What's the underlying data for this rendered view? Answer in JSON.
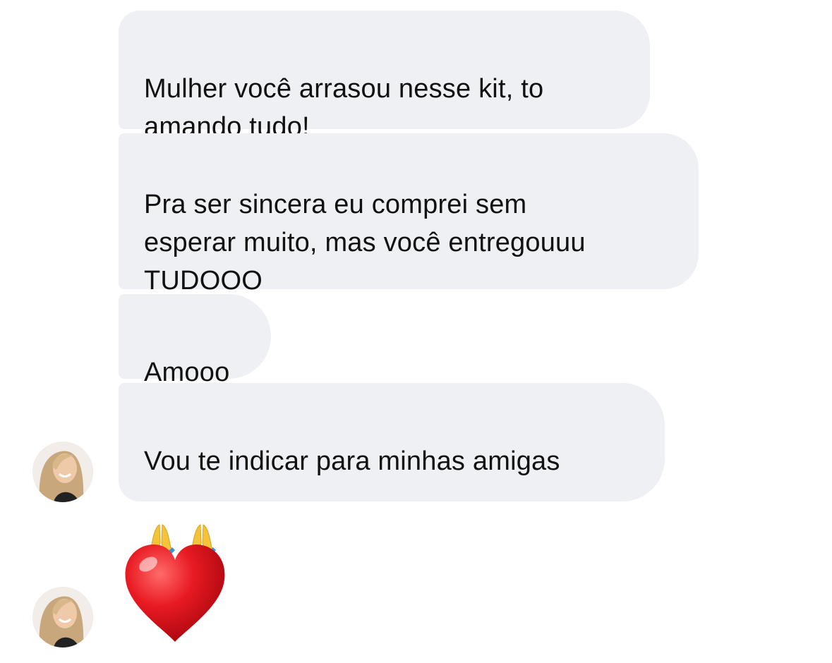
{
  "conversation": {
    "messages": [
      {
        "text": "Mulher você arrasou nesse kit, to\namando tudo!"
      },
      {
        "text": "Pra ser sincera eu comprei sem\nesperar muito, mas você entregouuu\nTUDOOO"
      },
      {
        "text": "Amooo"
      },
      {
        "text": "Vou te indicar para minhas amigas",
        "emojis": [
          "folded-hands-emoji",
          "folded-hands-emoji"
        ]
      }
    ],
    "reaction": {
      "icon": "red-heart-emoji"
    },
    "avatar_icon": "avatar-photo"
  },
  "colors": {
    "bubble_background": "#eff0f4",
    "text": "#111111",
    "heart": "#e0101a"
  }
}
